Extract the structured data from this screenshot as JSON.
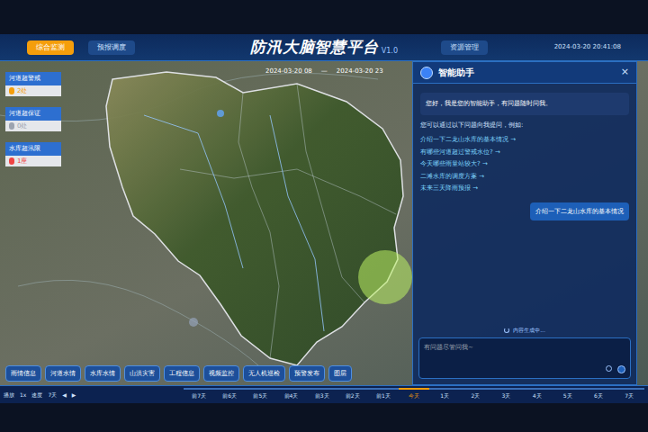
{
  "header": {
    "title": "防汛大脑智慧平台",
    "version": "V1.0",
    "time": "2024-03-20 20:41:08",
    "nav_left": [
      {
        "label": "综合监测",
        "selected": true
      },
      {
        "label": "预报调度",
        "selected": false
      }
    ],
    "nav_right": [
      {
        "label": "资源管理",
        "selected": false
      }
    ]
  },
  "date_range": {
    "start": "2024-03-20 08",
    "separator": "—",
    "end": "2024-03-20 23"
  },
  "alerts": [
    {
      "label": "河道超警戒",
      "value": "2处",
      "color": "#f59e0b"
    },
    {
      "label": "河道超保证",
      "value": "0处",
      "color": "#9ca3af"
    },
    {
      "label": "水库超汛限",
      "value": "1座",
      "color": "#ef4444"
    }
  ],
  "assistant": {
    "title": "智能助手",
    "close": "×",
    "greeting": "您好，我是您的智能助手，有问题随时问我。",
    "intro": "您可以通过以下问题向我提问，例如:",
    "suggestions": [
      "介绍一下二龙山水库的基本情况 →",
      "有哪些河道超过警戒水位? →",
      "今天哪些雨量站较大? →",
      "二滩水库的调度方案 →",
      "未来三天降雨预报 →"
    ],
    "user_message": "介绍一下二龙山水库的基本情况",
    "status": "内容生成中...",
    "placeholder": "有问题尽管问我~"
  },
  "layers": [
    {
      "label": "雨情信息",
      "selected": false
    },
    {
      "label": "河道水情",
      "selected": false
    },
    {
      "label": "水库水情",
      "selected": false
    },
    {
      "label": "山洪灾害",
      "selected": false
    },
    {
      "label": "工程信息",
      "selected": false
    },
    {
      "label": "视频监控",
      "selected": false
    },
    {
      "label": "无人机巡检",
      "selected": false
    },
    {
      "label": "预警发布",
      "selected": false
    },
    {
      "label": "图层",
      "selected": false
    }
  ],
  "timeline": {
    "controls": [
      "播放",
      "1x",
      "速度",
      "7天",
      "◀",
      "▶"
    ],
    "days": [
      {
        "label": "前7天",
        "selected": false
      },
      {
        "label": "前6天",
        "selected": false
      },
      {
        "label": "前5天",
        "selected": false
      },
      {
        "label": "前4天",
        "selected": false
      },
      {
        "label": "前3天",
        "selected": false
      },
      {
        "label": "前2天",
        "selected": false
      },
      {
        "label": "前1天",
        "selected": false
      },
      {
        "label": "今天",
        "selected": true
      },
      {
        "label": "1天",
        "selected": false
      },
      {
        "label": "2天",
        "selected": false
      },
      {
        "label": "3天",
        "selected": false
      },
      {
        "label": "4天",
        "selected": false
      },
      {
        "label": "5天",
        "selected": false
      },
      {
        "label": "6天",
        "selected": false
      },
      {
        "label": "7天",
        "selected": false
      }
    ]
  }
}
